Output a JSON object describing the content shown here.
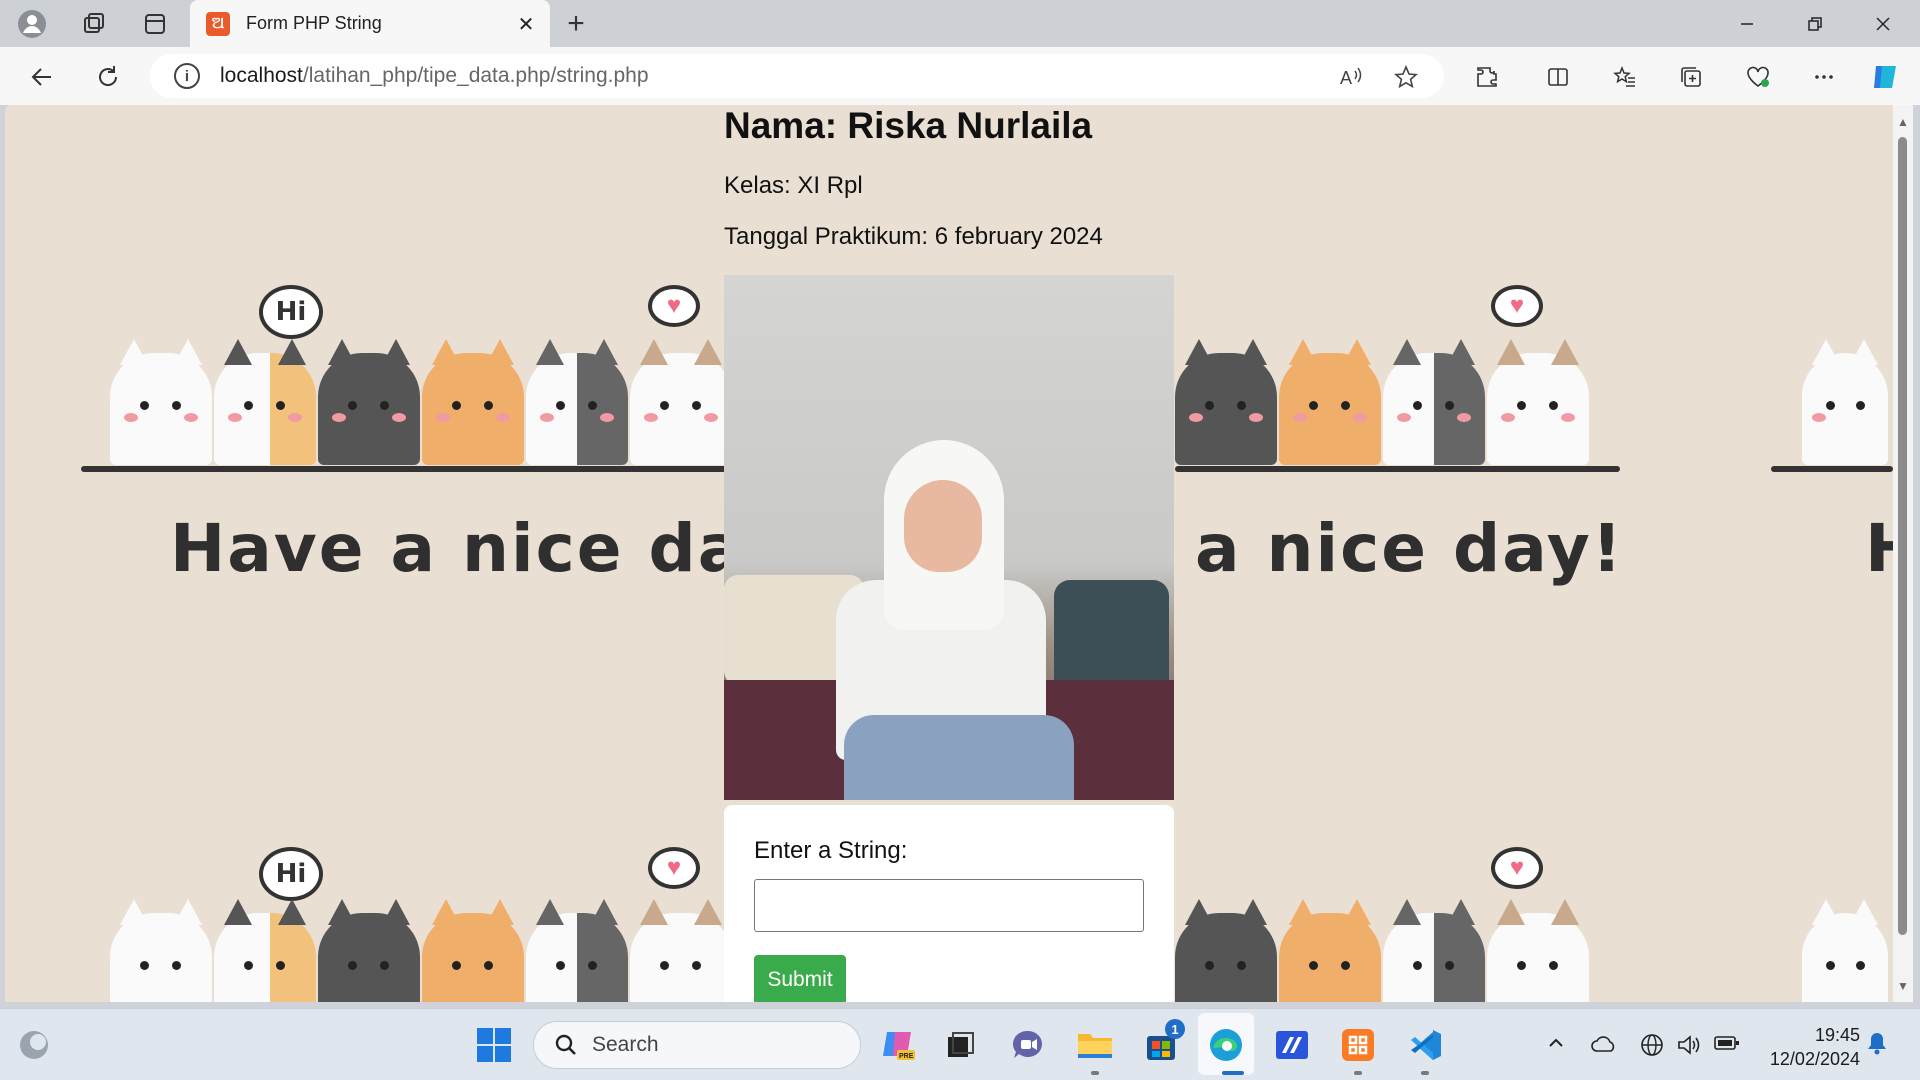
{
  "browser": {
    "tab_title": "Form PHP String",
    "url_host": "localhost",
    "url_path": "/latihan_php/tipe_data.php/string.php",
    "new_tab_symbol": "+",
    "close_symbol": "✕"
  },
  "page": {
    "nama": "Nama: Riska Nurlaila",
    "kelas": "Kelas: XI Rpl",
    "tanggal": "Tanggal Praktikum: 6 february 2024",
    "background_text_left": "Have a nice day!",
    "background_text_right": "a nice day!",
    "background_text_far": "H",
    "bubble_hi": "Hi",
    "form": {
      "label": "Enter a String:",
      "input_value": "",
      "submit_label": "Submit"
    }
  },
  "taskbar": {
    "search_placeholder": "Search",
    "store_badge": "1",
    "time": "19:45",
    "date": "12/02/2024"
  },
  "colors": {
    "page_background": "#eadfd3",
    "submit_button": "#3aab4a",
    "tab_favicon": "#ea5b2b"
  }
}
